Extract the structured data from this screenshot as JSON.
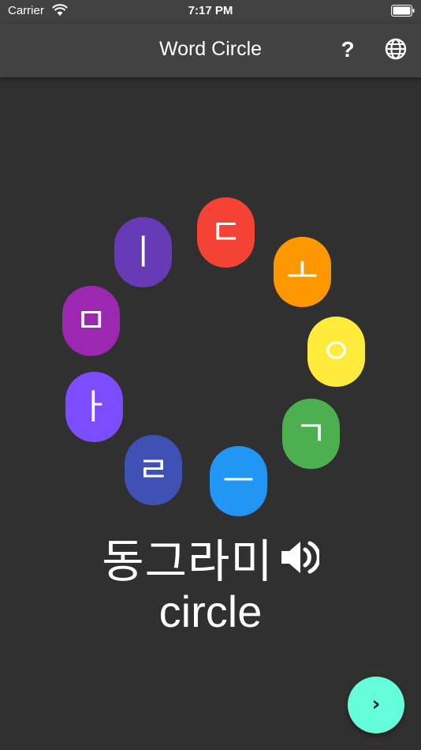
{
  "status_bar": {
    "carrier": "Carrier",
    "time": "7:17 PM"
  },
  "app_bar": {
    "title": "Word Circle",
    "help_label": "?"
  },
  "tiles": [
    {
      "letter": "ㄷ",
      "color": "#f44336"
    },
    {
      "letter": "ㅗ",
      "color": "#ff9800"
    },
    {
      "letter": "ㅇ",
      "color": "#ffeb3b"
    },
    {
      "letter": "ㄱ",
      "color": "#4caf50"
    },
    {
      "letter": "ㅡ",
      "color": "#2196f3"
    },
    {
      "letter": "ㄹ",
      "color": "#3f51b5"
    },
    {
      "letter": "ㅏ",
      "color": "#7c4dff"
    },
    {
      "letter": "ㅁ",
      "color": "#9c27b0"
    },
    {
      "letter": "ㅣ",
      "color": "#673ab7"
    }
  ],
  "word": {
    "korean": "동그라미",
    "english": "circle"
  },
  "next_button": {
    "label": "›",
    "color": "#64ffda"
  }
}
